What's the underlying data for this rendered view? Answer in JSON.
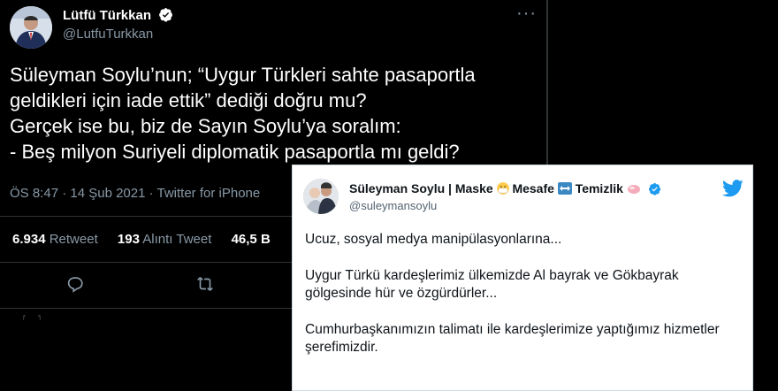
{
  "main_tweet": {
    "author_name": "Lütfü Türkkan",
    "handle": "@LutfuTurkkan",
    "body_lines": [
      "Süleyman Soylu’nun; “Uygur Türkleri sahte pasaportla",
      "geldikleri için iade ettik” dediği doğru mu?",
      "Gerçek ise bu, biz de Sayın Soylu’ya soralım:",
      "- Beş milyon Suriyeli diplomatik pasaportla mı geldi?"
    ],
    "meta": "ÖS 8:47 · 14 Şub 2021 · Twitter for iPhone",
    "stats": {
      "retweet_count": "6.934",
      "retweet_label": "Retweet",
      "quote_count": "193",
      "quote_label": "Alıntı Tweet",
      "like_count": "46,5 B"
    }
  },
  "quoted_tweet": {
    "name_prefix": "Süleyman Soylu | Maske",
    "name_mid": "Mesafe",
    "name_suffix": "Temizlik",
    "handle": "@suleymansoylu",
    "paragraphs": [
      "Ucuz, sosyal medya manipülasyonlarına...",
      "Uygur Türkü kardeşlerimiz ülkemizde Al bayrak ve Gökbayrak gölgesinde hür ve özgürdürler...",
      "Cumhurbaşkanımızın talimatı ile kardeşlerimize yaptığımız hizmetler\nşerefimizdir."
    ]
  },
  "colors": {
    "verified": "#1d9bf0",
    "twitter_blue": "#1d9bf0",
    "muted_dark": "#8899a6"
  },
  "icons": [
    "verified-icon",
    "more-icon",
    "reply-icon",
    "retweet-icon",
    "twitter-bird-icon",
    "mask-emoji-icon",
    "arrows-emoji-icon",
    "soap-emoji-icon"
  ]
}
